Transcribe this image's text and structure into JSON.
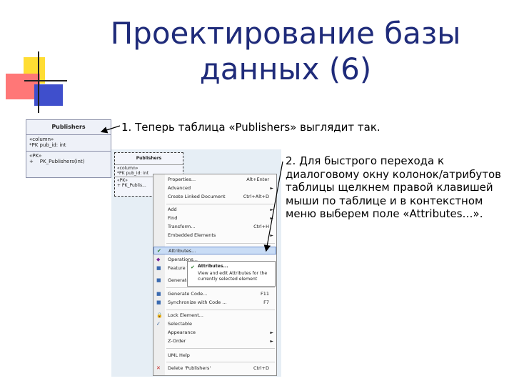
{
  "title": "Проектирование базы данных (6)",
  "step1": "1. Теперь таблица «Publishers» выглядит так.",
  "step2": "2. Для быстрого перехода к диалоговому окну колонок/атрибутов таблицы щелкнем правой клавишей мыши по таблице и в контекстном меню выберем поле «Attributes…».",
  "uml_class": {
    "name": "Publishers",
    "attributes_stereotype": "«column»",
    "attribute": "*PK pub_id: int",
    "operations_stereotype": "«PK»",
    "operation_prefix": "+",
    "operation": "PK_Publishers(int)"
  },
  "uml_selected": {
    "name": "Publishers",
    "attributes_stereotype": "«column»",
    "attribute": "*PK pub_id: int",
    "operations_stereotype": "«PK»",
    "operation": "+ PK_Publis..."
  },
  "context_menu": {
    "items": [
      {
        "label": "Properties...",
        "shortcut": "Alt+Enter",
        "arrow": "",
        "icon": ""
      },
      {
        "label": "Advanced",
        "shortcut": "",
        "arrow": "►",
        "icon": ""
      },
      {
        "label": "Create Linked Document",
        "shortcut": "Ctrl+Alt+D",
        "arrow": "",
        "icon": ""
      },
      {
        "label": "Add",
        "shortcut": "",
        "arrow": "►",
        "icon": ""
      },
      {
        "label": "Find",
        "shortcut": "",
        "arrow": "►",
        "icon": ""
      },
      {
        "label": "Transform...",
        "shortcut": "Ctrl+H",
        "arrow": "",
        "icon": ""
      },
      {
        "label": "Embedded Elements",
        "shortcut": "",
        "arrow": "►",
        "icon": ""
      },
      {
        "label": "Attributes...",
        "shortcut": "",
        "arrow": "",
        "icon": "✔"
      },
      {
        "label": "Operations...",
        "shortcut": "",
        "arrow": "",
        "icon": "◆"
      },
      {
        "label": "Feature Visibility...",
        "shortcut": "",
        "arrow": "",
        "icon": "■"
      },
      {
        "label": "Generate...",
        "shortcut": "",
        "arrow": "",
        "icon": "■"
      },
      {
        "label": "Generate Code...",
        "shortcut": "F11",
        "arrow": "",
        "icon": "■"
      },
      {
        "label": "Synchronize with Code ...",
        "shortcut": "F7",
        "arrow": "",
        "icon": "■"
      },
      {
        "label": "Lock Element...",
        "shortcut": "",
        "arrow": "",
        "icon": "🔒"
      },
      {
        "label": "Selectable",
        "shortcut": "",
        "arrow": "",
        "icon": "✓"
      },
      {
        "label": "Appearance",
        "shortcut": "",
        "arrow": "►",
        "icon": ""
      },
      {
        "label": "Z-Order",
        "shortcut": "",
        "arrow": "►",
        "icon": ""
      },
      {
        "label": "UML Help",
        "shortcut": "",
        "arrow": "",
        "icon": ""
      },
      {
        "label": "Delete 'Publishers'",
        "shortcut": "Ctrl+D",
        "arrow": "",
        "icon": "✕"
      }
    ],
    "highlighted_index": 7
  },
  "tooltip": {
    "title": "Attributes...",
    "description": "View and edit Attributes for the currently selected element"
  },
  "colors": {
    "title": "#1f2b7a",
    "highlight": "#c9dcf5"
  }
}
